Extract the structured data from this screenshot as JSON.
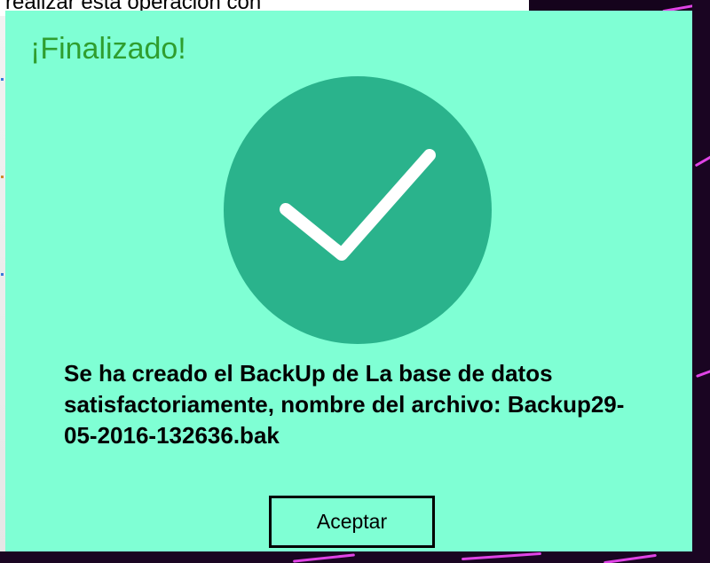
{
  "background_window": {
    "text": "realizar esta operacion con"
  },
  "dialog": {
    "title": "¡Finalizado!",
    "icon": "checkmark-circle-icon",
    "message": "Se ha creado el BackUp de La base de datos satisfactoriamente, nombre del archivo: Backup29-05-2016-132636.bak",
    "accept_label": "Aceptar"
  },
  "colors": {
    "dialog_background": "#7fffd4",
    "title_text": "#2f9e2f",
    "check_circle": "#2ab38c",
    "checkmark": "#ffffff",
    "button_border": "#000000"
  }
}
